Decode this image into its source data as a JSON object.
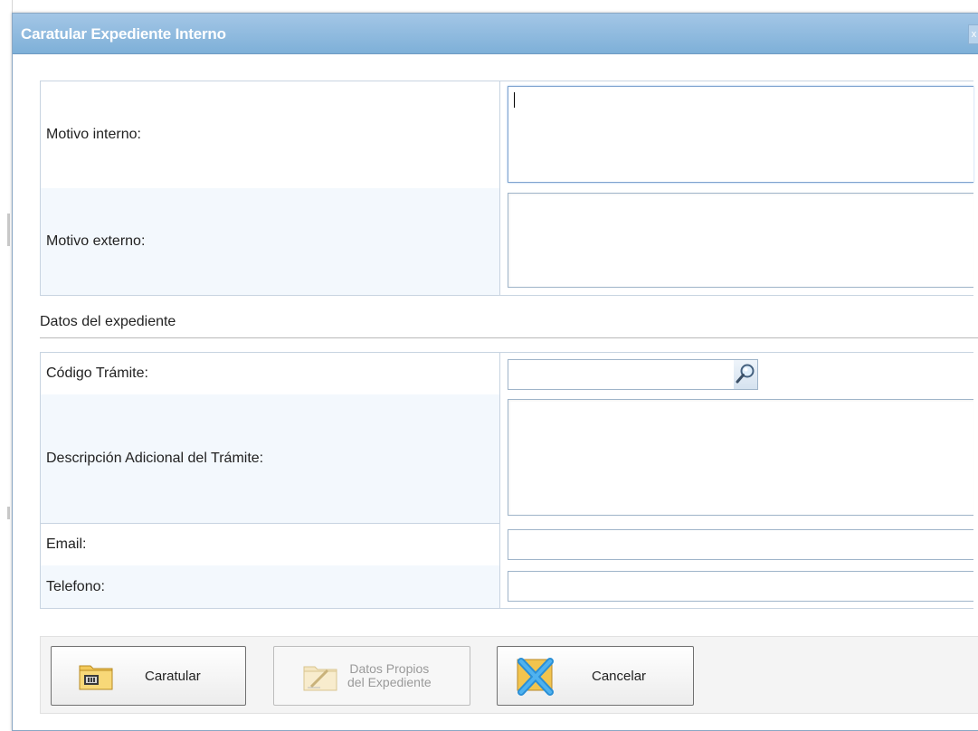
{
  "dialog": {
    "title": "Caratular Expediente Interno",
    "close_icon": "close-icon",
    "close_label": "x"
  },
  "fields": {
    "motivo_interno_label": "Motivo interno:",
    "motivo_interno_value": "",
    "motivo_externo_label": "Motivo externo:",
    "motivo_externo_value": ""
  },
  "section": {
    "title": "Datos del expediente"
  },
  "expediente": {
    "codigo_label": "Código Trámite:",
    "codigo_value": "",
    "search_icon": "magnifier-icon",
    "descripcion_label": "Descripción Adicional del Trámite:",
    "descripcion_value": "",
    "email_label": "Email:",
    "email_value": "",
    "telefono_label": "Telefono:",
    "telefono_value": ""
  },
  "buttons": {
    "caratular_label": "Caratular",
    "caratular_icon": "folder-stamp-icon",
    "datos_label_line1": "Datos Propios",
    "datos_label_line2": "del Expediente",
    "datos_icon": "folder-edit-icon",
    "cancelar_label": "Cancelar",
    "cancelar_icon": "cancel-x-icon"
  },
  "colors": {
    "titlebar": "#8fbbe0",
    "alt_row": "#f3f8fd",
    "border": "#c8d4e1"
  }
}
